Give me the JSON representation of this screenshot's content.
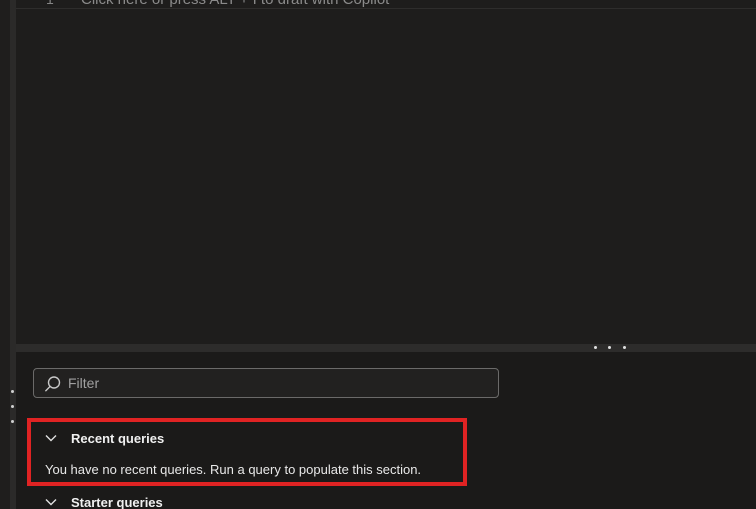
{
  "editor": {
    "line_number": "1",
    "placeholder": "Click here or press ALT + I to draft with Copilot"
  },
  "filter": {
    "placeholder": "Filter",
    "value": ""
  },
  "sections": {
    "recent": {
      "title": "Recent queries",
      "empty_message": "You have no recent queries. Run a query to populate this section."
    },
    "starter": {
      "title": "Starter queries"
    }
  },
  "colors": {
    "highlight": "#e02323",
    "background": "#1b1a19"
  },
  "icons": {
    "filter": "search-icon",
    "section_toggle": "chevron-down-icon"
  }
}
